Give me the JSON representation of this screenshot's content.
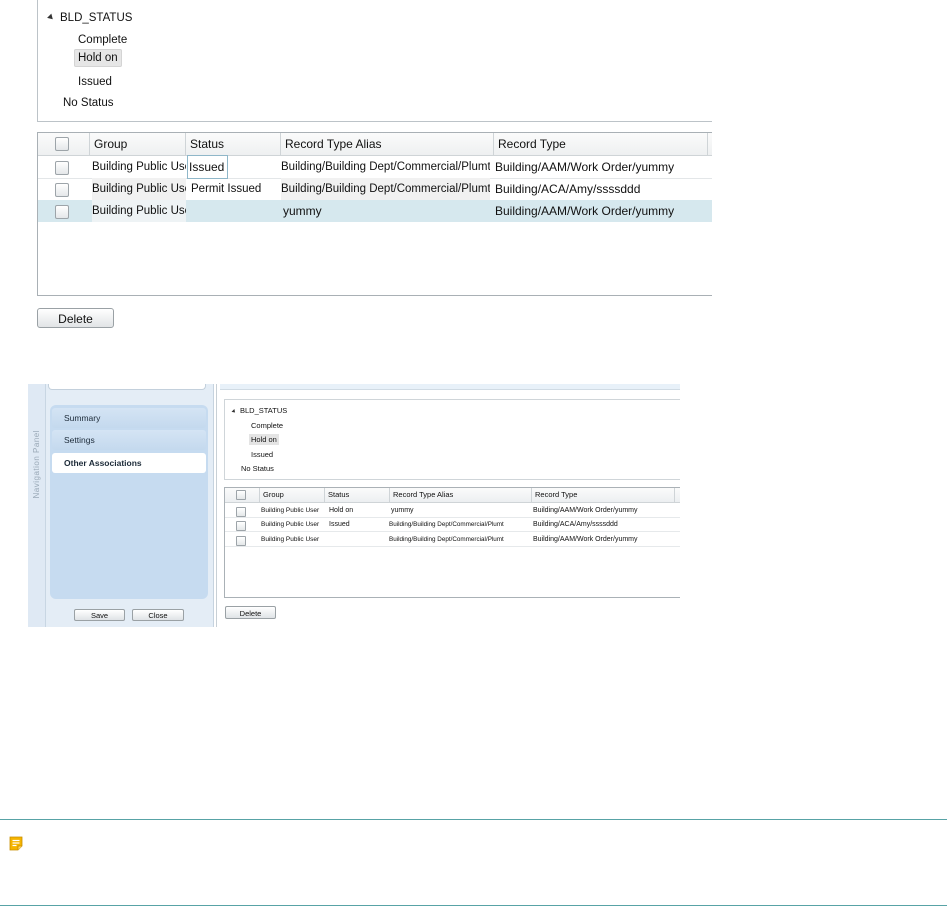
{
  "large": {
    "tree": {
      "root": "BLD_STATUS",
      "children": [
        "Complete",
        "Hold on",
        "Issued"
      ],
      "extra": "No Status",
      "highlighted_index": 1
    },
    "grid": {
      "columns": [
        "Group",
        "Status",
        "Record Type Alias",
        "Record Type"
      ],
      "rows": [
        {
          "group": "Building Public User",
          "status": "Issued",
          "alias": "Building/Building Dept/Commercial/Plumt",
          "type": "Building/AAM/Work Order/yummy"
        },
        {
          "group": "Building Public User",
          "status": "Permit Issued",
          "alias": "Building/Building Dept/Commercial/Plumt",
          "type": "Building/ACA/Amy/ssssddd"
        },
        {
          "group": "Building Public User",
          "status": "",
          "alias": "yummy",
          "type": "Building/AAM/Work Order/yummy"
        }
      ],
      "selected_row": 2
    },
    "delete_label": "Delete"
  },
  "small": {
    "nav": {
      "title": "Navigation Panel",
      "items": [
        "Summary",
        "Settings",
        "Other Associations"
      ],
      "active_index": 2,
      "save_label": "Save",
      "close_label": "Close"
    },
    "tree": {
      "root": "BLD_STATUS",
      "children": [
        "Complete",
        "Hold on",
        "Issued"
      ],
      "extra": "No Status",
      "highlighted_index": 1
    },
    "grid": {
      "columns": [
        "Group",
        "Status",
        "Record Type Alias",
        "Record Type"
      ],
      "rows": [
        {
          "group": "Building Public User",
          "status": "Hold on",
          "alias": "yummy",
          "type": "Building/AAM/Work Order/yummy"
        },
        {
          "group": "Building Public User",
          "status": "Issued",
          "alias": "Building/Building Dept/Commercial/Plumt",
          "type": "Building/ACA/Amy/ssssddd"
        },
        {
          "group": "Building Public User",
          "status": "",
          "alias": "Building/Building Dept/Commercial/Plumt",
          "type": "Building/AAM/Work Order/yummy"
        }
      ]
    },
    "delete_label": "Delete"
  },
  "note": {
    "icon": "note-icon",
    "accent": "#58a3a6",
    "icon_color": "#f5b400"
  }
}
